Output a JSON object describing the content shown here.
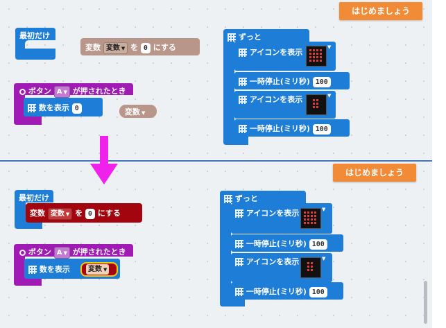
{
  "start_button_label": "はじめましょう",
  "colors": {
    "basic": "#1e7dd6",
    "variables": "#b8978a",
    "variables_error": "#a3050e",
    "input": "#a01bb3",
    "arrow": "#ef21ea",
    "start_button": "#f28b38"
  },
  "before": {
    "on_start": {
      "label": "最初だけ"
    },
    "set_variable": {
      "label_prefix": "変数",
      "variable": "変数",
      "label_mid": "を",
      "value": "0",
      "label_suffix": "にする"
    },
    "on_button": {
      "label_prefix": "ボタン",
      "button": "A",
      "label_suffix": "が押されたとき"
    },
    "show_number": {
      "label": "数を表示",
      "value": "0"
    },
    "loose_variable": {
      "variable": "変数"
    },
    "forever": {
      "label": "ずっと",
      "steps": [
        {
          "label": "アイコンを表示"
        },
        {
          "label": "一時停止(ミリ秒)",
          "value": "100"
        },
        {
          "label": "アイコンを表示"
        },
        {
          "label": "一時停止(ミリ秒)",
          "value": "100"
        }
      ]
    }
  },
  "after": {
    "on_start": {
      "label": "最初だけ"
    },
    "set_variable": {
      "label_prefix": "変数",
      "variable": "変数",
      "label_mid": "を",
      "value": "0",
      "label_suffix": "にする"
    },
    "on_button": {
      "label_prefix": "ボタン",
      "button": "A",
      "label_suffix": "が押されたとき"
    },
    "show_number": {
      "label": "数を表示",
      "variable": "変数"
    },
    "forever": {
      "label": "ずっと",
      "steps": [
        {
          "label": "アイコンを表示"
        },
        {
          "label": "一時停止(ミリ秒)",
          "value": "100"
        },
        {
          "label": "アイコンを表示"
        },
        {
          "label": "一時停止(ミリ秒)",
          "value": "100"
        }
      ]
    }
  }
}
